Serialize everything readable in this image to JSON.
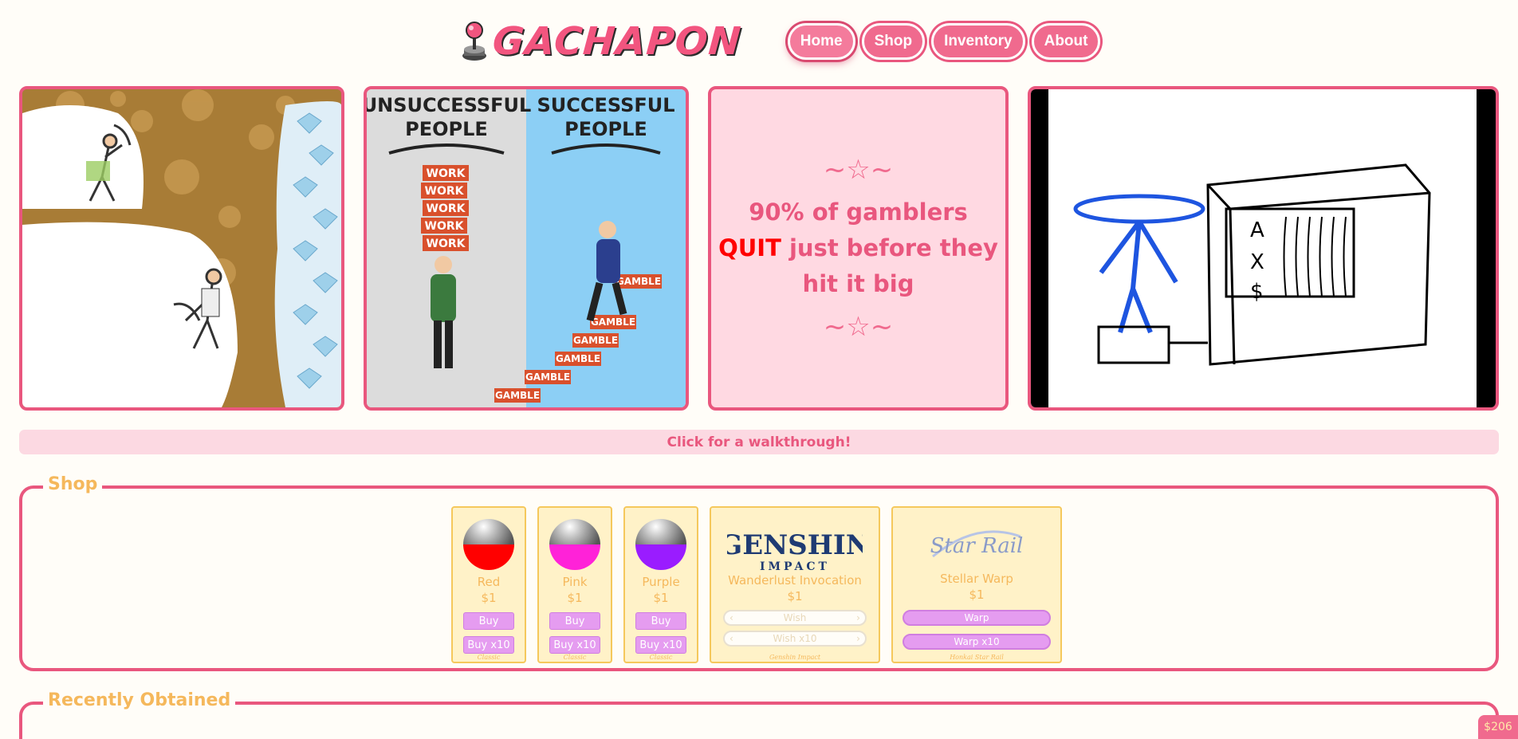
{
  "header": {
    "logo_text": "GACHAPON",
    "nav": [
      {
        "label": "Home",
        "active": true
      },
      {
        "label": "Shop",
        "active": false
      },
      {
        "label": "Inventory",
        "active": false
      },
      {
        "label": "About",
        "active": false
      }
    ]
  },
  "banners": {
    "meme2": {
      "left_title": "UNSUCCESSFUL PEOPLE",
      "right_title": "SUCCESSFUL PEOPLE",
      "work_blocks": [
        "WORK",
        "WORK",
        "WORK",
        "WORK",
        "WORK"
      ],
      "gamble_blocks": [
        "GAMBLE",
        "GAMBLE",
        "GAMBLE",
        "GAMBLE",
        "GAMBLE",
        "GAMBLE"
      ]
    },
    "quote": {
      "stars_top": "~☆~",
      "line1": "90% of gamblers",
      "quit_word": "QUIT",
      "line2_rest": " just before they",
      "line3": "hit it big",
      "stars_bottom": "~☆~"
    },
    "drawing_slot_letters": [
      "A",
      "X",
      "$"
    ]
  },
  "walkthrough_label": "Click for a walkthrough!",
  "shop": {
    "title": "Shop",
    "classic": [
      {
        "name": "Red",
        "price": "$1",
        "color": "#ff0000",
        "buy": "Buy",
        "buy10": "Buy x10",
        "caption": "Classic"
      },
      {
        "name": "Pink",
        "price": "$1",
        "color": "#ff22d8",
        "buy": "Buy",
        "buy10": "Buy x10",
        "caption": "Classic"
      },
      {
        "name": "Purple",
        "price": "$1",
        "color": "#9a1cff",
        "buy": "Buy",
        "buy10": "Buy x10",
        "caption": "Classic"
      }
    ],
    "genshin": {
      "logo_main": "GENSHIN",
      "logo_sub": "IMPACT",
      "name": "Wanderlust Invocation",
      "price": "$1",
      "btn1": "Wish",
      "btn10": "Wish x10",
      "caption": "Genshin Impact"
    },
    "starrail": {
      "logo_main": "Star Rail",
      "name": "Stellar Warp",
      "price": "$1",
      "btn1": "Warp",
      "btn10": "Warp x10",
      "caption": "Honkai Star Rail"
    }
  },
  "recent": {
    "title": "Recently Obtained"
  },
  "balance": "$206",
  "colors": {
    "accent": "#e9577e",
    "gold": "#f5b85c",
    "pink_bg": "#ffd9e2"
  }
}
